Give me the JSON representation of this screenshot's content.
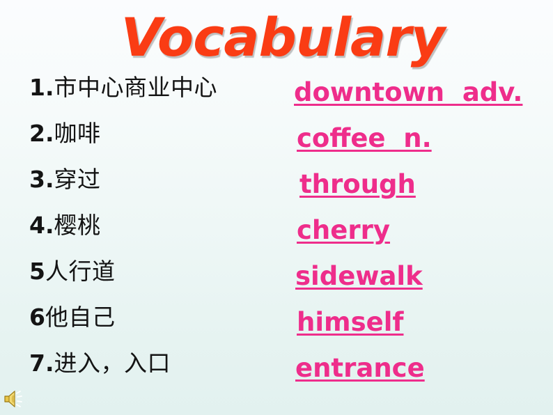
{
  "slide": {
    "title": "Vocabulary",
    "title_color": "#fa3c14",
    "chinese_color": "#141414",
    "english_color": "#ee2d8b",
    "background_top": "#fbfcfe",
    "background_bottom": "#e2f1ef"
  },
  "vocabulary": [
    {
      "number": "1.",
      "chinese": "市中心商业中心",
      "english": "downtown  adv."
    },
    {
      "number": "2.",
      "chinese": "咖啡",
      "english": "coffee  n."
    },
    {
      "number": "3.",
      "chinese": "穿过",
      "english": "through"
    },
    {
      "number": "4.",
      "chinese": "樱桃",
      "english": "cherry"
    },
    {
      "number": "5",
      "chinese": "人行道",
      "english": "sidewalk"
    },
    {
      "number": "6",
      "chinese": "他自己",
      "english": "himself"
    },
    {
      "number": "7.",
      "chinese": "进入，入口",
      "english": "entrance"
    }
  ],
  "media": {
    "speaker_icon": "speaker-icon"
  }
}
